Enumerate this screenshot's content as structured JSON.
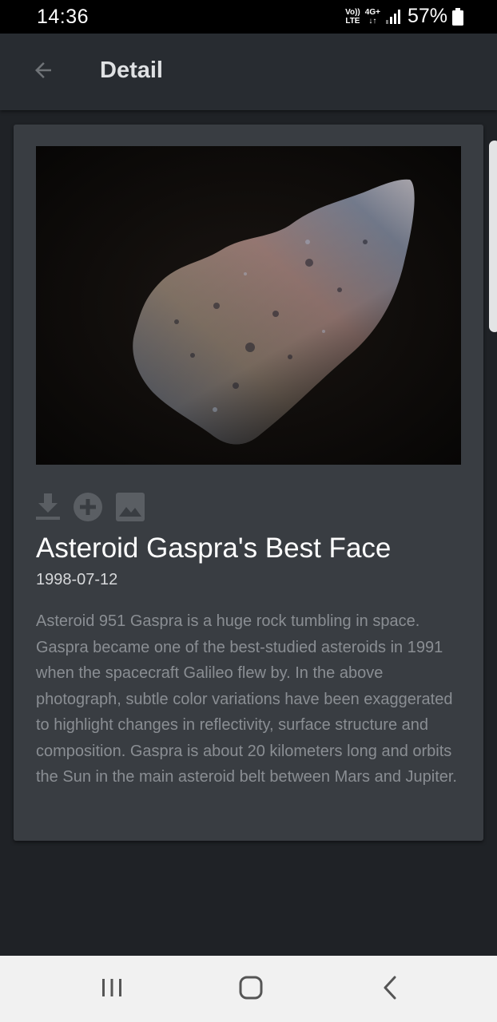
{
  "status_bar": {
    "time": "14:36",
    "volte_top": "Vo))",
    "volte_bottom": "LTE",
    "network_top": "4G+",
    "network_bottom": "↓↑",
    "battery": "57%"
  },
  "app_bar": {
    "title": "Detail",
    "back_icon": "arrow-left-icon"
  },
  "detail": {
    "image_alt": "Asteroid Gaspra",
    "actions": [
      {
        "icon": "download-icon"
      },
      {
        "icon": "add-circle-icon"
      },
      {
        "icon": "image-icon"
      }
    ],
    "title": "Asteroid Gaspra's Best Face",
    "date": "1998-07-12",
    "description": "Asteroid 951 Gaspra is a huge rock tumbling in space. Gaspra became one of the best-studied asteroids in 1991 when the spacecraft Galileo flew by. In the above photograph, subtle color variations have been exaggerated to highlight changes in reflectivity, surface structure and composition. Gaspra is about 20 kilometers long and orbits the Sun in the main asteroid belt between Mars and Jupiter."
  },
  "nav_bar": {
    "recents_icon": "recents-icon",
    "home_icon": "home-icon",
    "back_icon": "back-chevron-icon"
  },
  "colors": {
    "background": "#1f2226",
    "app_bar": "#282c31",
    "card": "#393d42",
    "text_primary": "#ffffff",
    "text_secondary": "#8a8e93"
  }
}
